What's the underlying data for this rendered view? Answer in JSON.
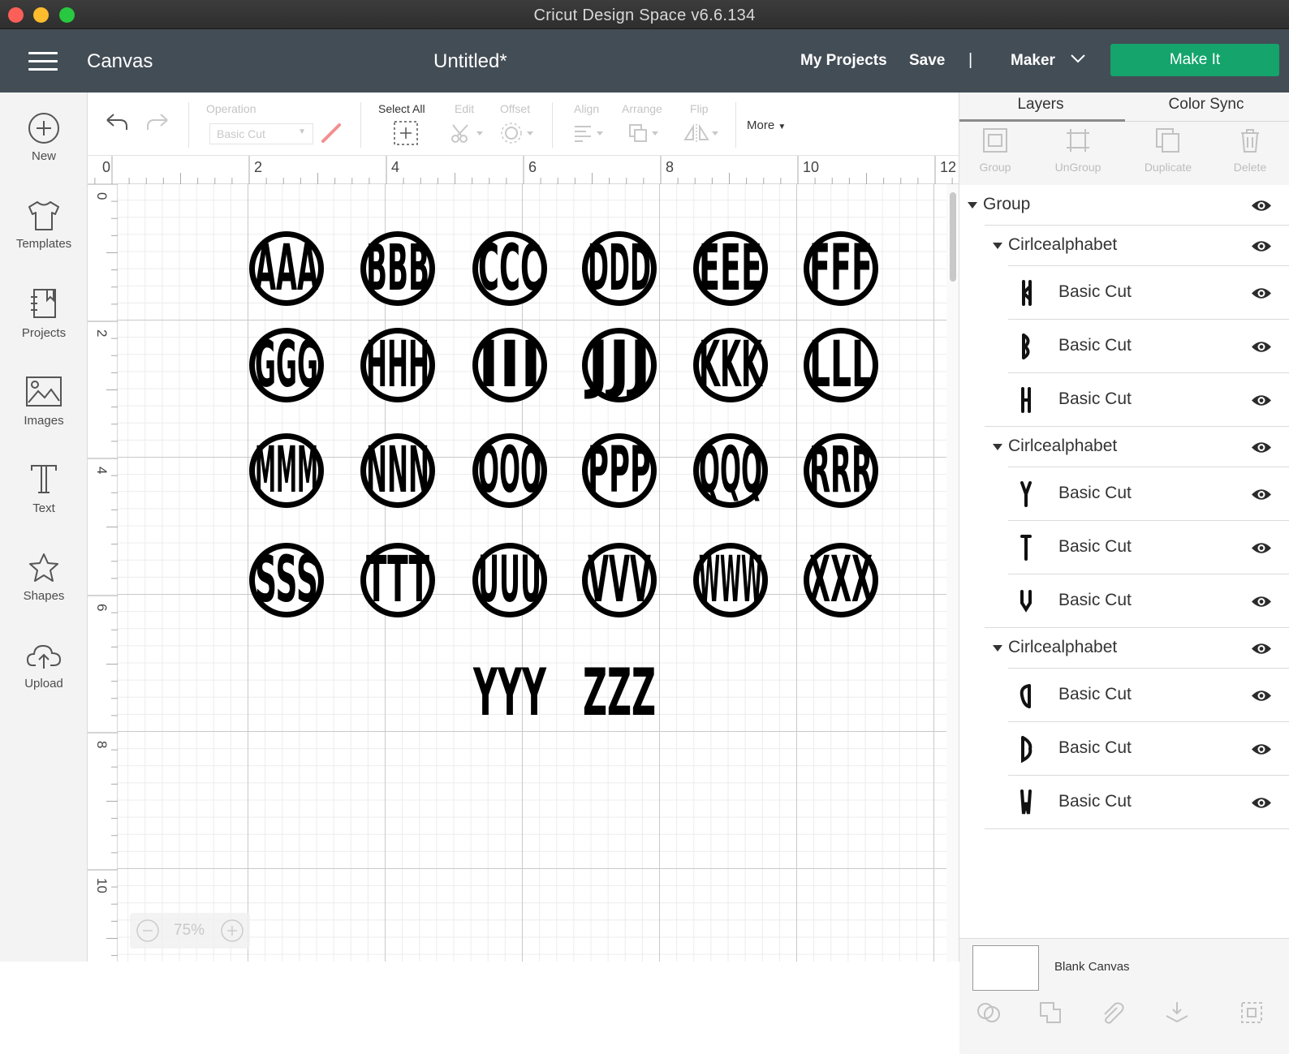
{
  "window": {
    "title": "Cricut Design Space  v6.6.134"
  },
  "header": {
    "section": "Canvas",
    "document_title": "Untitled*",
    "my_projects": "My Projects",
    "save": "Save",
    "separator": "|",
    "machine": "Maker",
    "make_it": "Make It",
    "make_it_color": "#14a46c",
    "background_color": "#434d56"
  },
  "sidebar": {
    "items": [
      {
        "label": "New",
        "icon": "plus-circle-icon"
      },
      {
        "label": "Templates",
        "icon": "shirt-icon"
      },
      {
        "label": "Projects",
        "icon": "projects-icon"
      },
      {
        "label": "Images",
        "icon": "image-icon"
      },
      {
        "label": "Text",
        "icon": "text-icon"
      },
      {
        "label": "Shapes",
        "icon": "shapes-icon"
      },
      {
        "label": "Upload",
        "icon": "upload-cloud-icon"
      }
    ]
  },
  "toolbar": {
    "operation_label": "Operation",
    "operation_value": "Basic Cut",
    "select_all": "Select All",
    "edit": "Edit",
    "offset": "Offset",
    "align": "Align",
    "arrange": "Arrange",
    "flip": "Flip",
    "more": "More"
  },
  "rulers": {
    "top_labels": [
      "0",
      "2",
      "4",
      "6",
      "8",
      "10",
      "12"
    ],
    "left_labels": [
      "0",
      "2",
      "4",
      "6",
      "8",
      "10"
    ]
  },
  "canvas": {
    "monograms": [
      "AAA",
      "BBB",
      "CCC",
      "DDD",
      "EEE",
      "FFF",
      "GGG",
      "HHH",
      "III",
      "JJJ",
      "KKK",
      "LLL",
      "MMM",
      "NNN",
      "OOO",
      "PPP",
      "QQQ",
      "RRR",
      "SSS",
      "TTT",
      "UUU",
      "VVV",
      "WWW",
      "XXX",
      "YYY",
      "ZZZ"
    ],
    "zoom": "75%"
  },
  "right_panel": {
    "tabs": [
      "Layers",
      "Color Sync"
    ],
    "tools": [
      "Group",
      "UnGroup",
      "Duplicate",
      "Delete"
    ],
    "layers": [
      {
        "label": "Group",
        "level": 0
      },
      {
        "label": "Cirlcealphabet",
        "level": 1
      },
      {
        "label": "Basic Cut",
        "level": 2
      },
      {
        "label": "Basic Cut",
        "level": 2
      },
      {
        "label": "Basic Cut",
        "level": 2
      },
      {
        "label": "Cirlcealphabet",
        "level": 1
      },
      {
        "label": "Basic Cut",
        "level": 2
      },
      {
        "label": "Basic Cut",
        "level": 2
      },
      {
        "label": "Basic Cut",
        "level": 2
      },
      {
        "label": "Cirlcealphabet",
        "level": 1
      },
      {
        "label": "Basic Cut",
        "level": 2
      },
      {
        "label": "Basic Cut",
        "level": 2
      },
      {
        "label": "Basic Cut",
        "level": 2
      }
    ],
    "blank_canvas": "Blank Canvas"
  }
}
